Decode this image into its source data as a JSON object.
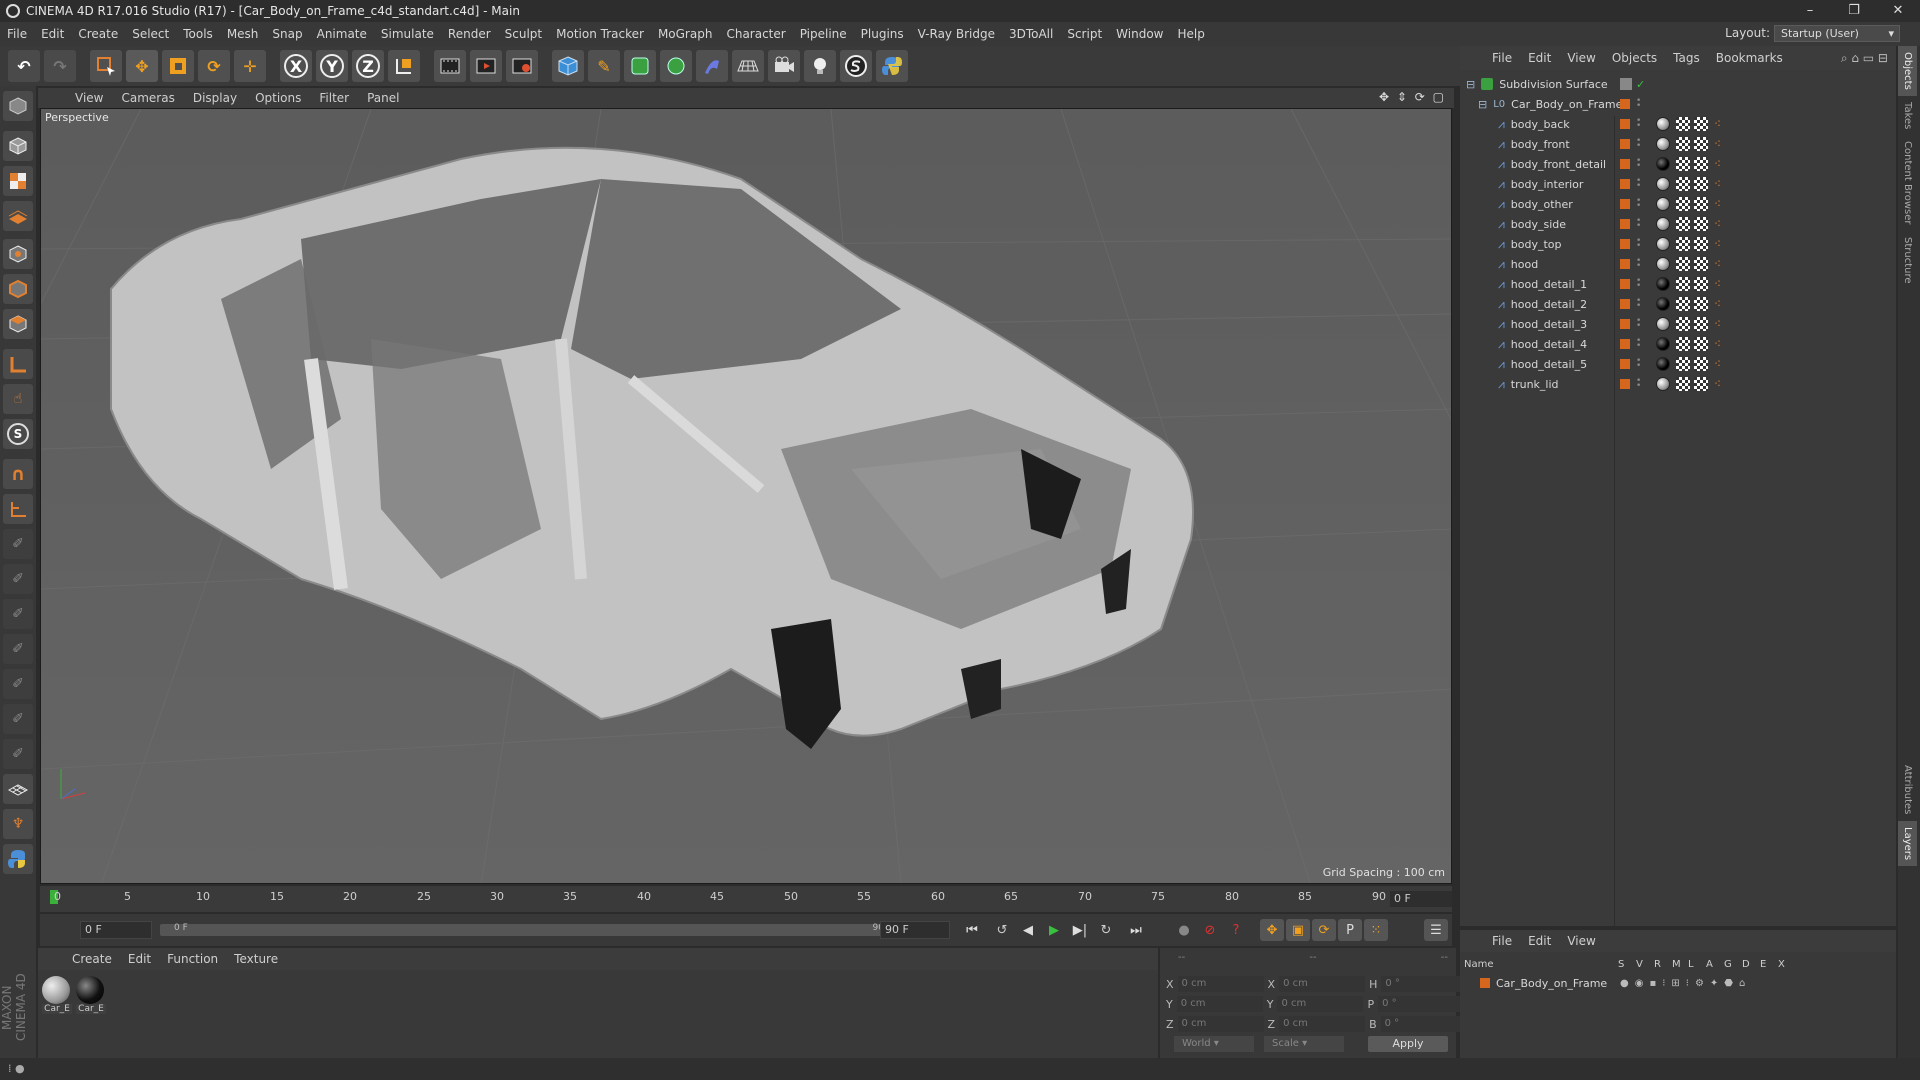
{
  "window": {
    "title": "CINEMA 4D R17.016 Studio (R17) - [Car_Body_on_Frame_c4d_standart.c4d] - Main",
    "controls": [
      "–",
      "❐",
      "✕"
    ]
  },
  "menubar": {
    "items": [
      "File",
      "Edit",
      "Create",
      "Select",
      "Tools",
      "Mesh",
      "Snap",
      "Animate",
      "Simulate",
      "Render",
      "Sculpt",
      "Motion Tracker",
      "MoGraph",
      "Character",
      "Pipeline",
      "Plugins",
      "V-Ray Bridge",
      "3DToAll",
      "Script",
      "Window",
      "Help"
    ],
    "layout_label": "Layout:",
    "layout_value": "Startup (User)"
  },
  "toolbar": {
    "icons": [
      "undo-icon",
      "redo-icon",
      "live-select-icon",
      "move-icon",
      "scale-icon",
      "rotate-icon",
      "move-axis-icon",
      "x-axis-icon",
      "y-axis-icon",
      "z-axis-icon",
      "coordinate-system-icon",
      "render-view-icon",
      "render-picture-viewer-icon",
      "edit-render-settings-icon",
      "cube-icon",
      "pen-icon",
      "subdivision-icon",
      "mograph-cloner-icon",
      "deformer-icon",
      "floor-icon",
      "camera-icon",
      "light-icon",
      "sketch-icon",
      "python-icon"
    ],
    "axis_labels": [
      "X",
      "Y",
      "Z"
    ]
  },
  "viewport": {
    "menu": [
      "View",
      "Cameras",
      "Display",
      "Options",
      "Filter",
      "Panel"
    ],
    "label": "Perspective",
    "grid_spacing": "Grid Spacing : 100 cm"
  },
  "timeline": {
    "ticks": [
      "0",
      "5",
      "10",
      "15",
      "20",
      "25",
      "30",
      "35",
      "40",
      "45",
      "50",
      "55",
      "60",
      "65",
      "70",
      "75",
      "80",
      "85",
      "90"
    ],
    "current_frame": "0 F",
    "start_field": "0 F",
    "range_start": "0 F",
    "range_end": "90 F",
    "end_field": "90 F"
  },
  "material_manager": {
    "menu": [
      "Create",
      "Edit",
      "Function",
      "Texture"
    ],
    "materials": [
      {
        "label": "Car_E",
        "color": "#9a9a9a"
      },
      {
        "label": "Car_E",
        "color": "#111111"
      }
    ]
  },
  "coordinates": {
    "header": [
      "--",
      "--",
      "--"
    ],
    "rows": [
      {
        "a": "X",
        "av": "0 cm",
        "b": "X",
        "bv": "0 cm",
        "c": "H",
        "cv": "0 °"
      },
      {
        "a": "Y",
        "av": "0 cm",
        "b": "Y",
        "bv": "0 cm",
        "c": "P",
        "cv": "0 °"
      },
      {
        "a": "Z",
        "av": "0 cm",
        "b": "Z",
        "bv": "0 cm",
        "c": "B",
        "cv": "0 °"
      }
    ],
    "mode": "World",
    "transform": "Scale",
    "apply": "Apply"
  },
  "object_manager": {
    "menu": [
      "File",
      "Edit",
      "View",
      "Objects",
      "Tags",
      "Bookmarks"
    ],
    "root": "Subdivision Surface",
    "group": "Car_Body_on_Frame",
    "objects": [
      {
        "name": "body_back",
        "mat": "grey"
      },
      {
        "name": "body_front",
        "mat": "grey"
      },
      {
        "name": "body_front_detail",
        "mat": "black"
      },
      {
        "name": "body_interior",
        "mat": "grey"
      },
      {
        "name": "body_other",
        "mat": "grey"
      },
      {
        "name": "body_side",
        "mat": "grey"
      },
      {
        "name": "body_top",
        "mat": "grey"
      },
      {
        "name": "hood",
        "mat": "grey"
      },
      {
        "name": "hood_detail_1",
        "mat": "black"
      },
      {
        "name": "hood_detail_2",
        "mat": "black"
      },
      {
        "name": "hood_detail_3",
        "mat": "grey"
      },
      {
        "name": "hood_detail_4",
        "mat": "black"
      },
      {
        "name": "hood_detail_5",
        "mat": "black"
      },
      {
        "name": "trunk_lid",
        "mat": "grey"
      }
    ]
  },
  "layer_manager": {
    "menu": [
      "File",
      "Edit",
      "View"
    ],
    "columns": [
      "Name",
      "S",
      "V",
      "R",
      "M",
      "L",
      "A",
      "G",
      "D",
      "E",
      "X"
    ],
    "layer_name": "Car_Body_on_Frame"
  },
  "right_tabs": [
    "Objects",
    "Takes",
    "Content Browser",
    "Structure",
    "Attributes",
    "Layers"
  ],
  "branding": "MAXON CINEMA 4D"
}
